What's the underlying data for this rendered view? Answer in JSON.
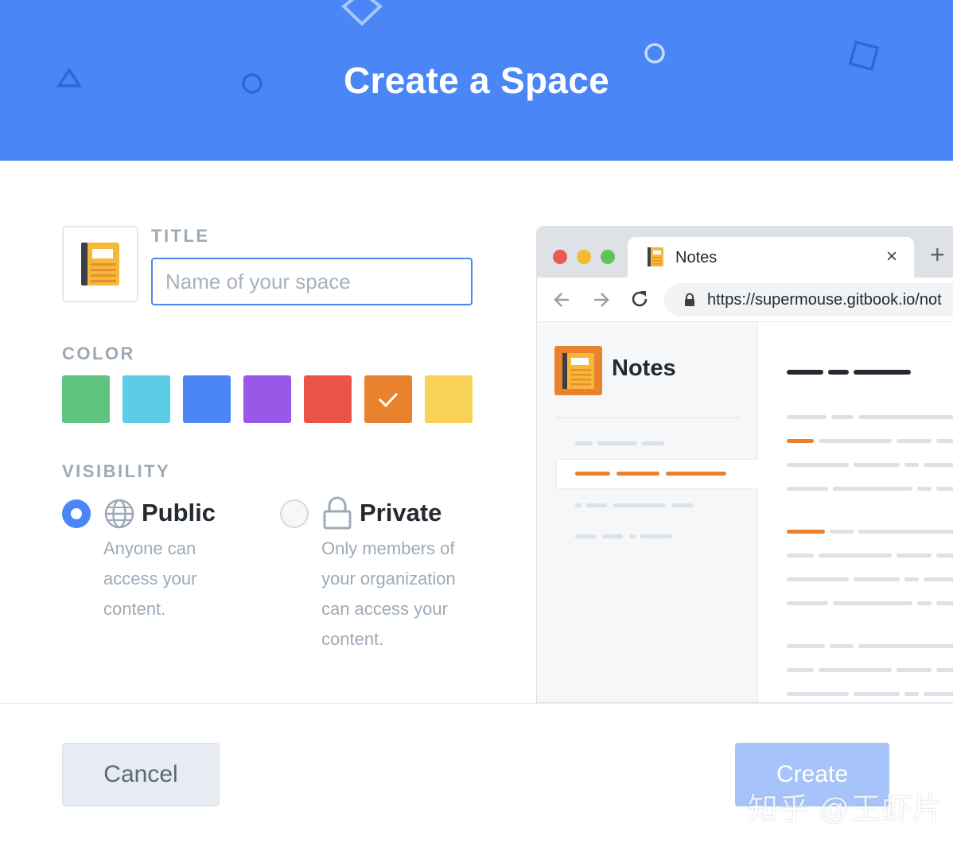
{
  "header": {
    "title": "Create a Space"
  },
  "form": {
    "title_label": "TITLE",
    "title_placeholder": "Name of your space",
    "title_value": "",
    "space_icon": "notebook-icon",
    "color_label": "COLOR",
    "colors": [
      "#5fc57e",
      "#5bcde6",
      "#4a86f5",
      "#9b57e8",
      "#ec5349",
      "#e8822d",
      "#f8d257"
    ],
    "selected_color_index": 5,
    "visibility_label": "VISIBILITY",
    "visibility": {
      "public": {
        "title": "Public",
        "desc_lines": [
          "Anyone can",
          "access your",
          "content."
        ],
        "selected": true,
        "icon": "globe-icon"
      },
      "private": {
        "title": "Private",
        "desc_lines": [
          "Only members of",
          "your organization",
          "can access your",
          "content."
        ],
        "selected": false,
        "icon": "lock-icon"
      }
    }
  },
  "preview": {
    "tab_title": "Notes",
    "tab_close": "×",
    "new_tab": "+",
    "address": "https://supermouse.gitbook.io/not",
    "space_title": "Notes",
    "accent_color": "#e8822d"
  },
  "footer": {
    "cancel_label": "Cancel",
    "create_label": "Create",
    "watermark": "知乎 @王虾片"
  }
}
